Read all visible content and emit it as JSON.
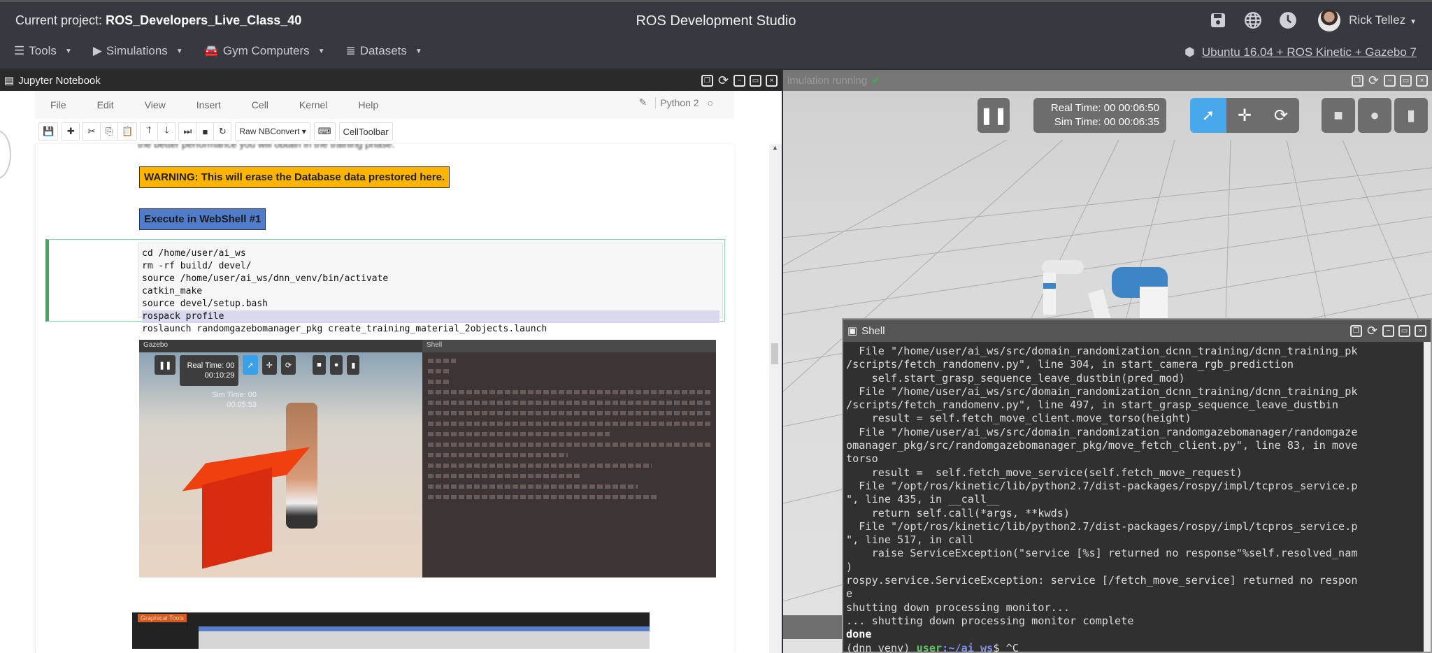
{
  "topbar": {
    "project_label": "Current project:",
    "project_name": "ROS_Developers_Live_Class_40",
    "app_title": "ROS Development Studio",
    "user_name": "Rick Tellez",
    "icons": [
      "save-icon",
      "globe-icon",
      "clock-icon"
    ],
    "menu": [
      {
        "label": "Tools",
        "icon": "bars-icon"
      },
      {
        "label": "Simulations",
        "icon": "play-circle-icon"
      },
      {
        "label": "Gym Computers",
        "icon": "car-icon"
      },
      {
        "label": "Datasets",
        "icon": "database-icon"
      }
    ],
    "environment": "Ubuntu 16.04 + ROS Kinetic + Gazebo 7"
  },
  "jupyter": {
    "window_title": "Jupyter Notebook",
    "menu": [
      "File",
      "Edit",
      "View",
      "Insert",
      "Cell",
      "Kernel",
      "Help"
    ],
    "kernel_name": "Python 2",
    "cell_type": "Raw NBConvert",
    "celltoolbar_label": "CellToolbar",
    "cut_text": "the better performance you will obtain in the training phase.",
    "warning_text": "WARNING: This will erase the Database data prestored here.",
    "execute_label": "Execute in WebShell #1",
    "code_lines": [
      "cd /home/user/ai_ws",
      "rm -rf build/ devel/",
      "source /home/user/ai_ws/dnn_venv/bin/activate",
      "catkin_make",
      "source devel/setup.bash",
      "rospack profile",
      "roslaunch randomgazebomanager_pkg create_training_material_2objects.launch"
    ],
    "embedded_image": {
      "gazebo_title": "Gazebo",
      "shell_title": "Shell",
      "real_time_label": "Real Time: 00",
      "real_time_value": "00:10:29",
      "sim_time_label": "Sim Time: 00",
      "sim_time_value": "00:05:53",
      "graphical_tools_label": "Graphical Tools"
    }
  },
  "gazebo": {
    "status": "imulation running",
    "real_time": "Real Time: 00 00:06:50",
    "sim_time": "Sim Time: 00 00:06:35"
  },
  "shell": {
    "title": "Shell",
    "lines": [
      "  File \"/home/user/ai_ws/src/domain_randomization_dcnn_training/dcnn_training_pk",
      "/scripts/fetch_randomenv.py\", line 304, in start_camera_rgb_prediction",
      "    self.start_grasp_sequence_leave_dustbin(pred_mod)",
      "  File \"/home/user/ai_ws/src/domain_randomization_dcnn_training/dcnn_training_pk",
      "/scripts/fetch_randomenv.py\", line 497, in start_grasp_sequence_leave_dustbin",
      "    result = self.fetch_move_client.move_torso(height)",
      "  File \"/home/user/ai_ws/src/domain_randomization_randomgazebomanager/randomgaze",
      "omanager_pkg/src/randomgazebomanager_pkg/move_fetch_client.py\", line 83, in move",
      "torso",
      "    result =  self.fetch_move_service(self.fetch_move_request)",
      "  File \"/opt/ros/kinetic/lib/python2.7/dist-packages/rospy/impl/tcpros_service.p",
      "\", line 435, in __call__",
      "    return self.call(*args, **kwds)",
      "  File \"/opt/ros/kinetic/lib/python2.7/dist-packages/rospy/impl/tcpros_service.p",
      "\", line 517, in call",
      "    raise ServiceException(\"service [%s] returned no response\"%self.resolved_nam",
      ")",
      "rospy.service.ServiceException: service [/fetch_move_service] returned no respon",
      "e",
      "shutting down processing monitor...",
      "... shutting down processing monitor complete"
    ],
    "done_line": "done",
    "prompt_env": "(dnn_venv) ",
    "prompt_user": "user",
    "prompt_path": ":~/ai_ws",
    "prompt_tail": "$ ^C"
  }
}
